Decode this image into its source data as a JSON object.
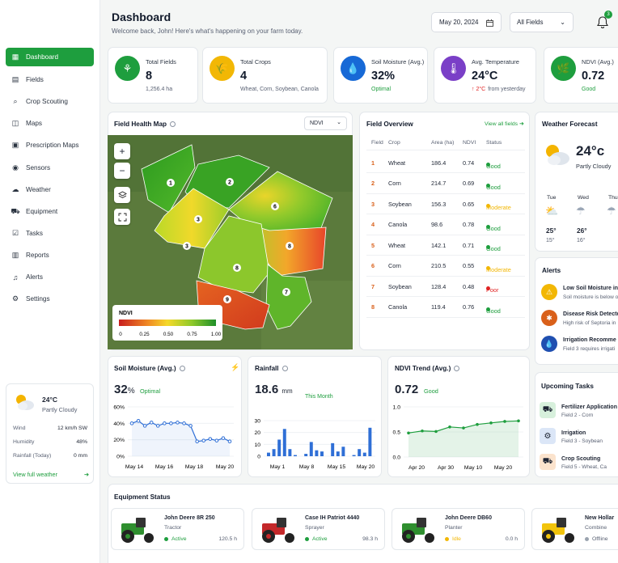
{
  "header": {
    "title": "Dashboard",
    "subtitle": "Welcome back, John! Here's what's happening on your farm today.",
    "date": "May 20, 2024",
    "fields_select": "All Fields",
    "notif_count": "3"
  },
  "nav": [
    {
      "label": "Dashboard",
      "icon": "grid-icon"
    },
    {
      "label": "Fields",
      "icon": "fields-icon"
    },
    {
      "label": "Crop Scouting",
      "icon": "scout-icon"
    },
    {
      "label": "Maps",
      "icon": "map-icon"
    },
    {
      "label": "Prescription Maps",
      "icon": "prescription-icon"
    },
    {
      "label": "Sensors",
      "icon": "sensor-icon"
    },
    {
      "label": "Weather",
      "icon": "weather-icon"
    },
    {
      "label": "Equipment",
      "icon": "tractor-icon"
    },
    {
      "label": "Tasks",
      "icon": "tasks-icon"
    },
    {
      "label": "Reports",
      "icon": "reports-icon"
    },
    {
      "label": "Alerts",
      "icon": "bell-icon"
    },
    {
      "label": "Settings",
      "icon": "gear-icon"
    }
  ],
  "side_weather": {
    "temp": "24°C",
    "cond": "Partly Cloudy",
    "rows": [
      {
        "k": "Wind",
        "v": "12 km/h SW"
      },
      {
        "k": "Humidity",
        "v": "48%"
      },
      {
        "k": "Rainfall (Today)",
        "v": "0 mm"
      }
    ],
    "link": "View full weather"
  },
  "stats": [
    {
      "label": "Total Fields",
      "value": "8",
      "sub": "1,256.4 ha",
      "color": "#1e9e3e"
    },
    {
      "label": "Total Crops",
      "value": "4",
      "sub": "Wheat, Corn, Soybean, Canola",
      "color": "#f2b705"
    },
    {
      "label": "Soil Moisture (Avg.)",
      "value": "32%",
      "sub": "Optimal",
      "color": "#1769d6"
    },
    {
      "label": "Avg. Temperature",
      "value": "24°C",
      "sub_a": "↑ 2°C",
      "sub_b": "from yesterday",
      "color": "#7a3fc7"
    },
    {
      "label": "NDVI (Avg.)",
      "value": "0.72",
      "sub": "Good",
      "color": "#1e9e3e"
    }
  ],
  "map": {
    "title": "Field Health Map",
    "select": "NDVI",
    "legend_title": "NDVI",
    "legend_ticks": [
      "0",
      "0.25",
      "0.50",
      "0.75",
      "1.00"
    ],
    "labels": [
      "1",
      "2",
      "3",
      "3",
      "6",
      "8",
      "8",
      "9",
      "7"
    ]
  },
  "overview": {
    "title": "Field Overview",
    "link": "View all fields",
    "cols": [
      "Field",
      "Crop",
      "Area (ha)",
      "NDVI",
      "Status"
    ],
    "rows": [
      {
        "f": "1",
        "c": "Wheat",
        "a": "186.4",
        "n": "0.74",
        "s": "Good",
        "sc": "#1e9e3e"
      },
      {
        "f": "2",
        "c": "Corn",
        "a": "214.7",
        "n": "0.69",
        "s": "Good",
        "sc": "#1e9e3e"
      },
      {
        "f": "3",
        "c": "Soybean",
        "a": "156.3",
        "n": "0.65",
        "s": "Moderate",
        "sc": "#f2b705"
      },
      {
        "f": "4",
        "c": "Canola",
        "a": "98.6",
        "n": "0.78",
        "s": "Good",
        "sc": "#1e9e3e"
      },
      {
        "f": "5",
        "c": "Wheat",
        "a": "142.1",
        "n": "0.71",
        "s": "Good",
        "sc": "#1e9e3e"
      },
      {
        "f": "6",
        "c": "Corn",
        "a": "210.5",
        "n": "0.55",
        "s": "Moderate",
        "sc": "#f2b705"
      },
      {
        "f": "7",
        "c": "Soybean",
        "a": "128.4",
        "n": "0.48",
        "s": "Poor",
        "sc": "#e02424"
      },
      {
        "f": "8",
        "c": "Canola",
        "a": "119.4",
        "n": "0.76",
        "s": "Good",
        "sc": "#1e9e3e"
      }
    ]
  },
  "forecast": {
    "title": "Weather Forecast",
    "temp": "24°c",
    "cond": "Partly Cloudy",
    "days": [
      {
        "d": "Tue",
        "hi": "25°",
        "lo": "15°"
      },
      {
        "d": "Wed",
        "hi": "26°",
        "lo": "16°"
      },
      {
        "d": "Thu",
        "hi": "",
        "lo": ""
      }
    ]
  },
  "alerts": {
    "title": "Alerts",
    "items": [
      {
        "t": "Low Soil Moisture in F",
        "s": "Soil moisture is below o",
        "color": "#f2b705"
      },
      {
        "t": "Disease Risk Detecte",
        "s": "High risk of Septoria in",
        "color": "#d9601a"
      },
      {
        "t": "Irrigation Recomme",
        "s": "Field 3 requires irrigati",
        "color": "#1f4fb0"
      }
    ]
  },
  "tasks": {
    "title": "Upcoming Tasks",
    "items": [
      {
        "t": "Fertilizer Application",
        "s": "Field 2 - Corn",
        "bg": "#d7f0dc"
      },
      {
        "t": "Irrigation",
        "s": "Field 3 - Soybean",
        "bg": "#dbe6f7"
      },
      {
        "t": "Crop Scouting",
        "s": "Field 5 - Wheat, Ca",
        "bg": "#fbe3cd"
      }
    ]
  },
  "soil_chart": {
    "title": "Soil Moisture (Avg.)",
    "value": "32",
    "unit": "%",
    "status": "Optimal",
    "yticks": [
      "60%",
      "40%",
      "20%",
      "0%"
    ],
    "xticks": [
      "May 14",
      "May 16",
      "May 18",
      "May 20"
    ]
  },
  "rain_chart": {
    "title": "Rainfall",
    "value": "18.6",
    "unit": "mm",
    "period": "This Month",
    "yticks": [
      "30",
      "20",
      "10",
      "0"
    ],
    "xticks": [
      "May 1",
      "May 8",
      "May 15",
      "May 20"
    ]
  },
  "ndvi_chart": {
    "title": "NDVI Trend (Avg.)",
    "value": "0.72",
    "status": "Good",
    "yticks": [
      "1.0",
      "0.5",
      "0.0"
    ],
    "xticks": [
      "Apr 20",
      "Apr 30",
      "May 10",
      "May 20"
    ]
  },
  "chart_data": [
    {
      "type": "line",
      "title": "Soil Moisture (Avg.)",
      "x": [
        "May 14",
        "",
        "",
        "",
        "",
        "May 16",
        "",
        "",
        "",
        "",
        "May 18",
        "",
        "",
        "",
        "",
        "May 20"
      ],
      "series": [
        {
          "values": [
            40,
            43,
            37,
            41,
            37,
            40,
            40,
            41,
            40,
            37,
            18,
            19,
            21,
            19,
            22,
            18
          ]
        }
      ],
      "ylim": [
        0,
        60
      ]
    },
    {
      "type": "bar",
      "title": "Rainfall",
      "categories": [
        "May 1",
        "",
        "",
        "",
        "",
        "",
        "",
        "May 8",
        "",
        "",
        "",
        "",
        "",
        "",
        "May 15",
        "",
        "",
        "",
        "",
        "May 20"
      ],
      "values": [
        3,
        6,
        14,
        23,
        6,
        1,
        0,
        2,
        12,
        5,
        4,
        0,
        11,
        4,
        8,
        0,
        1,
        6,
        3,
        24
      ],
      "ylim": [
        0,
        30
      ]
    },
    {
      "type": "area",
      "title": "NDVI Trend (Avg.)",
      "x": [
        "Apr 20",
        "",
        "Apr 30",
        "",
        "",
        "May 10",
        "",
        "",
        "May 20"
      ],
      "series": [
        {
          "values": [
            0.48,
            0.52,
            0.51,
            0.6,
            0.58,
            0.65,
            0.68,
            0.71,
            0.72
          ]
        }
      ],
      "ylim": [
        0,
        1.0
      ]
    }
  ],
  "equipment": {
    "title": "Equipment Status",
    "items": [
      {
        "name": "John Deere 8R 250",
        "type": "Tractor",
        "status": "Active",
        "hours": "120.5 h",
        "sc": "#1e9e3e",
        "color": "#2f8f2f"
      },
      {
        "name": "Case IH Patriot 4440",
        "type": "Sprayer",
        "status": "Active",
        "hours": "98.3 h",
        "sc": "#1e9e3e",
        "color": "#c4282a"
      },
      {
        "name": "John Deere DB60",
        "type": "Planter",
        "status": "Idle",
        "hours": "0.0 h",
        "sc": "#f2b705",
        "color": "#2f8f2f"
      },
      {
        "name": "New Hollar",
        "type": "Combine",
        "status": "Offline",
        "hours": "",
        "sc": "#9aa3af",
        "color": "#f2c40c"
      }
    ]
  }
}
